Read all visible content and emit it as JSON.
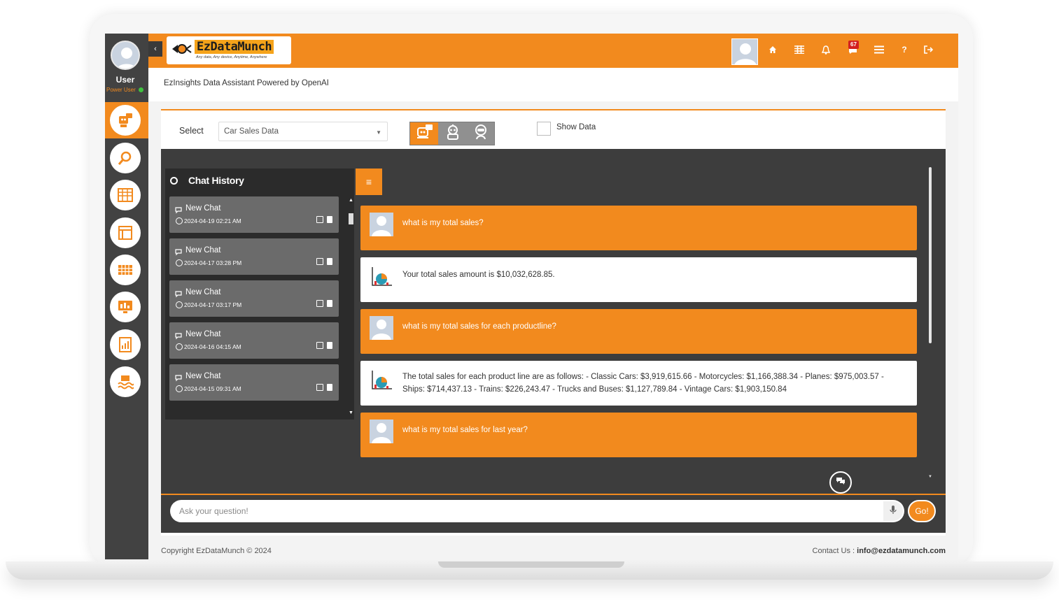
{
  "sidebar": {
    "user_name": "User",
    "user_role": "Power User",
    "items": [
      {
        "icon": "robot-chat-icon",
        "active": true
      },
      {
        "icon": "data-search-icon",
        "active": false
      },
      {
        "icon": "spreadsheet-icon",
        "active": false
      },
      {
        "icon": "layout-icon",
        "active": false
      },
      {
        "icon": "table-grid-icon",
        "active": false
      },
      {
        "icon": "dashboard-monitor-icon",
        "active": false
      },
      {
        "icon": "report-chart-icon",
        "active": false
      },
      {
        "icon": "data-lake-icon",
        "active": false
      }
    ]
  },
  "header": {
    "logo_text": "EzDataMunch",
    "logo_tagline": "Any data, Any device, Anytime, Anywhere",
    "notification_count": "67",
    "icons": [
      "home-icon",
      "grid-icon",
      "bell-icon",
      "notifications-icon",
      "list-icon",
      "help-icon",
      "logout-icon"
    ]
  },
  "subheader": {
    "title": "EzInsights Data Assistant Powered by OpenAI"
  },
  "toolbar": {
    "select_label": "Select",
    "select_value": "Car Sales Data",
    "show_data_label": "Show Data",
    "accent_color": "#f28a1e"
  },
  "history": {
    "title": "Chat History",
    "items": [
      {
        "label": "New Chat",
        "date": "2024-04-19 02:21 AM"
      },
      {
        "label": "New Chat",
        "date": "2024-04-17 03:28 PM"
      },
      {
        "label": "New Chat",
        "date": "2024-04-17 03:17 PM"
      },
      {
        "label": "New Chat",
        "date": "2024-04-16 04:15 AM"
      },
      {
        "label": "New Chat",
        "date": "2024-04-15 09:31 AM"
      }
    ]
  },
  "messages": [
    {
      "role": "user",
      "text": "what is my total sales?"
    },
    {
      "role": "bot",
      "text": "Your total sales amount is $10,032,628.85."
    },
    {
      "role": "user",
      "text": "what is my total sales for each productline?"
    },
    {
      "role": "bot",
      "text": "The total sales for each product line are as follows: - Classic Cars: $3,919,615.66 - Motorcycles: $1,166,388.34 - Planes: $975,003.57 - Ships: $714,437.13 - Trains: $226,243.47 - Trucks and Buses: $1,127,789.84 - Vintage Cars: $1,903,150.84"
    },
    {
      "role": "user",
      "text": "what is my total sales for last year?"
    }
  ],
  "input": {
    "placeholder": "Ask your question!",
    "go_label": "Go!"
  },
  "footer": {
    "copyright": "Copyright EzDataMunch © 2024",
    "contact_label": "Contact Us :",
    "contact_email": "info@ezdatamunch.com"
  }
}
